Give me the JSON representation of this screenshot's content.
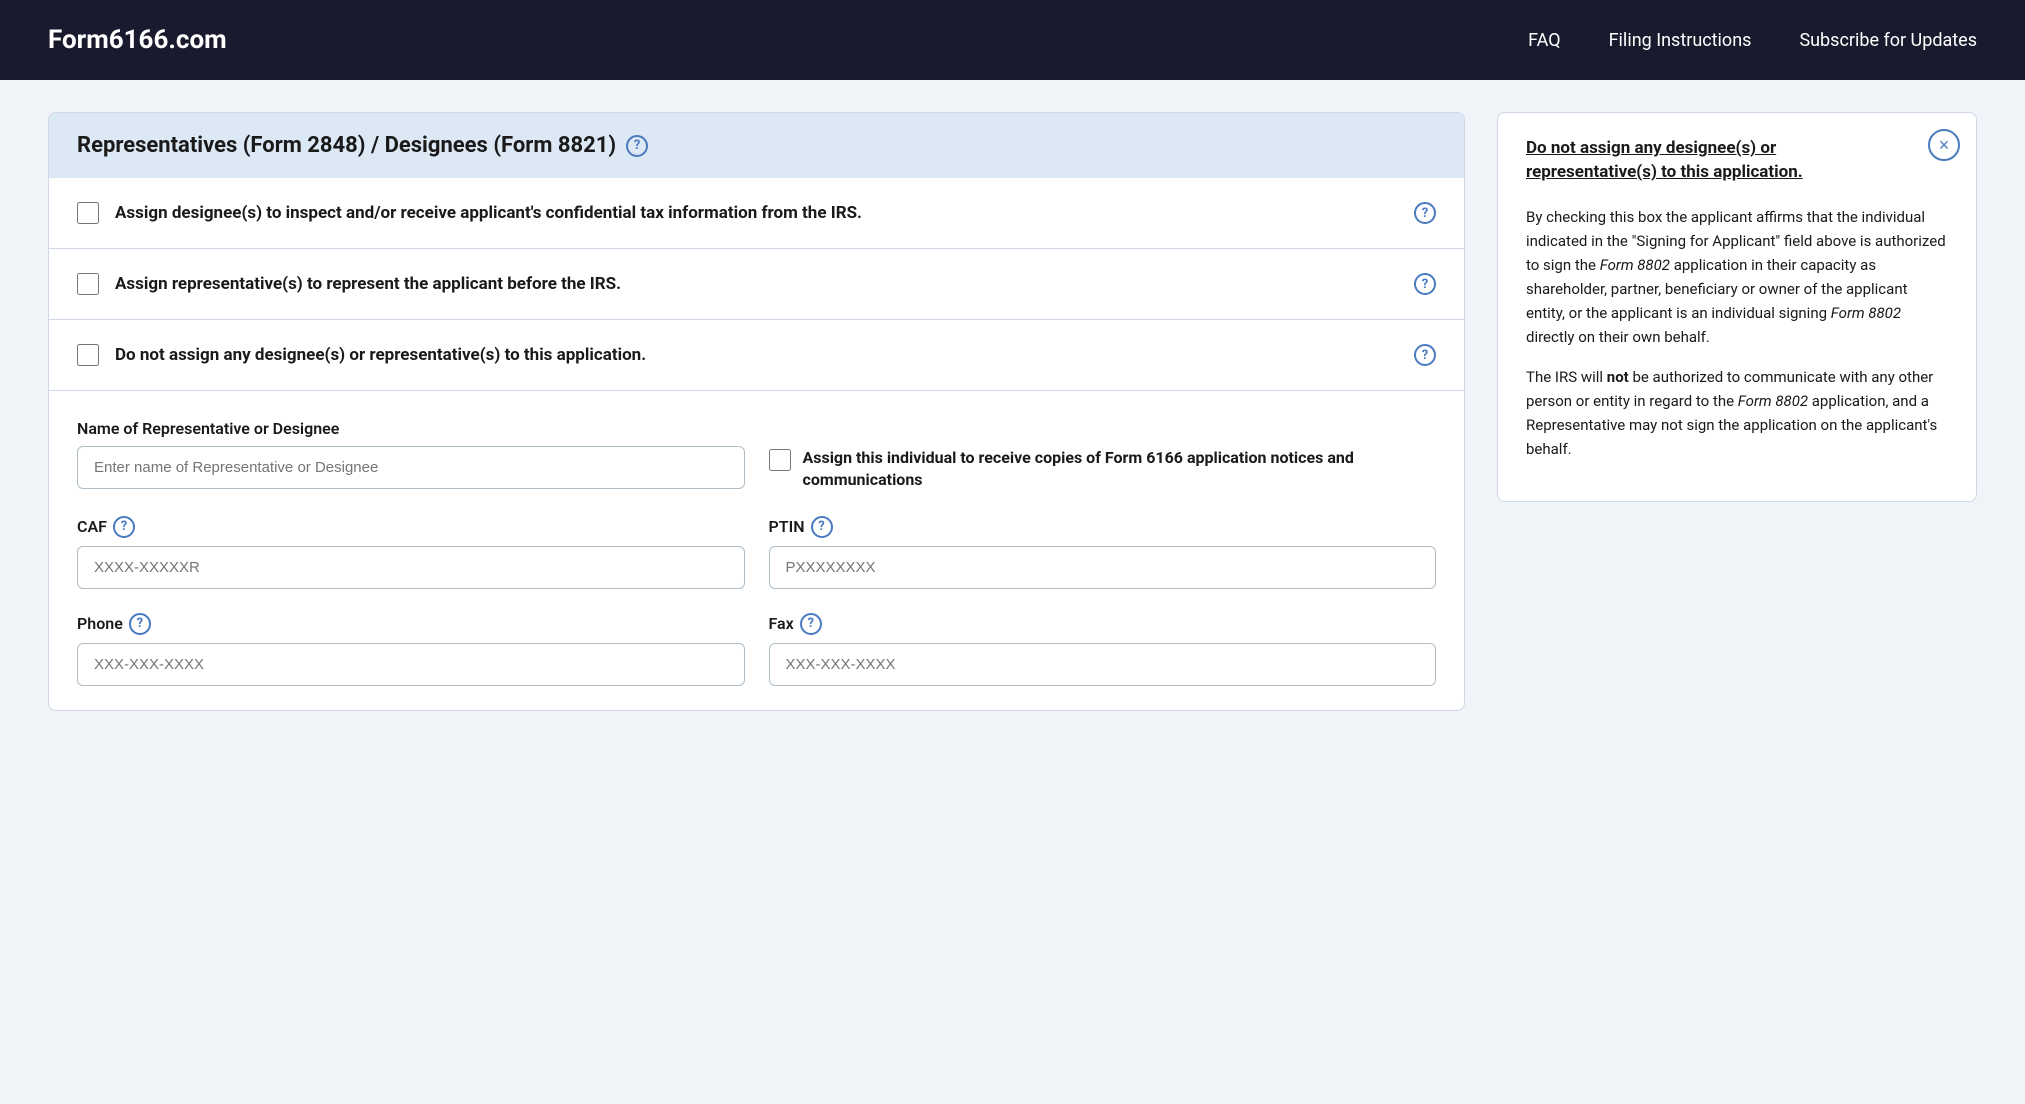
{
  "header": {
    "logo": "Form6166.com",
    "nav": {
      "faq": "FAQ",
      "filing_instructions": "Filing Instructions",
      "subscribe": "Subscribe for Updates"
    }
  },
  "section": {
    "title": "Representatives (Form 2848) / Designees (Form 8821)",
    "help_icon_label": "?",
    "checkboxes": [
      {
        "id": "cb1",
        "label": "Assign designee(s) to inspect and/or receive applicant's confidential tax information from the IRS.",
        "has_help": true
      },
      {
        "id": "cb2",
        "label": "Assign representative(s) to represent the applicant before the IRS.",
        "has_help": true
      },
      {
        "id": "cb3",
        "label": "Do not assign any designee(s) or representative(s) to this application.",
        "has_help": true
      }
    ],
    "fields": {
      "rep_name_label": "Name of Representative or Designee",
      "rep_name_placeholder": "Enter name of Representative or Designee",
      "assign_copies_label": "Assign this individual to receive copies of Form 6166 application notices and communications",
      "caf_label": "CAF",
      "caf_placeholder": "XXXX-XXXXXR",
      "ptin_label": "PTIN",
      "ptin_placeholder": "PXXXXXXXX",
      "phone_label": "Phone",
      "phone_placeholder": "XXX-XXX-XXXX",
      "fax_label": "Fax",
      "fax_placeholder": "XXX-XXX-XXXX"
    }
  },
  "tooltip": {
    "heading": "Do not assign any designee(s) or representative(s) to this application.",
    "paragraphs": [
      "By checking this box the applicant affirms that the individual indicated in the \"Signing for Applicant\" field above is authorized to sign the Form 8802 application in their capacity as shareholder, partner, beneficiary or owner of the applicant entity, or the applicant is an individual signing Form 8802 directly on their own behalf.",
      "The IRS will not be authorized to communicate with any other person or entity in regard to the Form 8802 application, and a Representative may not sign the application on the applicant's behalf."
    ],
    "form_italic_1": "Form 8802",
    "form_italic_2": "Form 8802",
    "form_italic_3": "Form 8802",
    "not_bold": "not",
    "close_label": "×"
  },
  "icons": {
    "help": "?",
    "close": "×"
  }
}
